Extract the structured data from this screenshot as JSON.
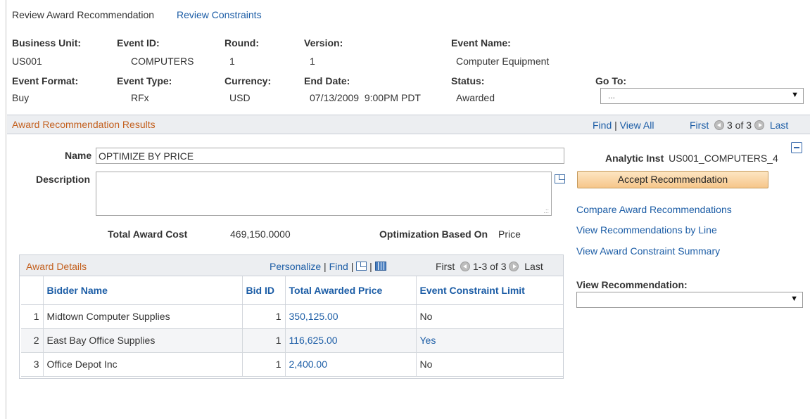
{
  "tabs": {
    "current": "Review Award Recommendation",
    "link": "Review Constraints"
  },
  "header": {
    "business_unit": {
      "label": "Business Unit:",
      "value": "US001"
    },
    "event_id": {
      "label": "Event ID:",
      "value": "COMPUTERS"
    },
    "round": {
      "label": "Round:",
      "value": "1"
    },
    "version": {
      "label": "Version:",
      "value": "1"
    },
    "event_name": {
      "label": "Event Name:",
      "value": "Computer Equipment"
    },
    "event_format": {
      "label": "Event Format:",
      "value": "Buy"
    },
    "event_type": {
      "label": "Event Type:",
      "value": "RFx"
    },
    "currency": {
      "label": "Currency:",
      "value": "USD"
    },
    "end_date": {
      "label": "End Date:",
      "value": "07/13/2009  9:00PM PDT"
    },
    "status": {
      "label": "Status:",
      "value": "Awarded"
    },
    "goto": {
      "label": "Go To:",
      "value": "..."
    }
  },
  "section": {
    "title": "Award Recommendation Results",
    "find": "Find",
    "view_all": "View All",
    "first": "First",
    "count": "3 of 3",
    "last": "Last"
  },
  "form": {
    "name_label": "Name",
    "name_value": "OPTIMIZE BY PRICE",
    "description_label": "Description",
    "description_value": "",
    "analytic_label": "Analytic Inst",
    "analytic_value": "US001_COMPUTERS_4",
    "accept_button": "Accept Recommendation",
    "total_cost_label": "Total Award Cost",
    "total_cost_value": "469,150.0000",
    "optimization_label": "Optimization Based On",
    "optimization_value": "Price"
  },
  "links": {
    "compare": "Compare Award Recommendations",
    "by_line": "View Recommendations by Line",
    "summary": "View Award Constraint Summary"
  },
  "view_recommendation": {
    "label": "View Recommendation:",
    "value": ""
  },
  "award_details": {
    "title": "Award Details",
    "personalize": "Personalize",
    "find": "Find",
    "first": "First",
    "count": "1-3 of 3",
    "last": "Last",
    "columns": [
      "Bidder Name",
      "Bid ID",
      "Total Awarded Price",
      "Event Constraint Limit"
    ],
    "rows": [
      {
        "num": "1",
        "bidder": "Midtown Computer Supplies",
        "bid_id": "1",
        "price": "350,125.00",
        "limit": "No"
      },
      {
        "num": "2",
        "bidder": "East Bay Office Supplies",
        "bid_id": "1",
        "price": "116,625.00",
        "limit": "Yes"
      },
      {
        "num": "3",
        "bidder": "Office Depot Inc",
        "bid_id": "1",
        "price": "2,400.00",
        "limit": "No"
      }
    ]
  }
}
